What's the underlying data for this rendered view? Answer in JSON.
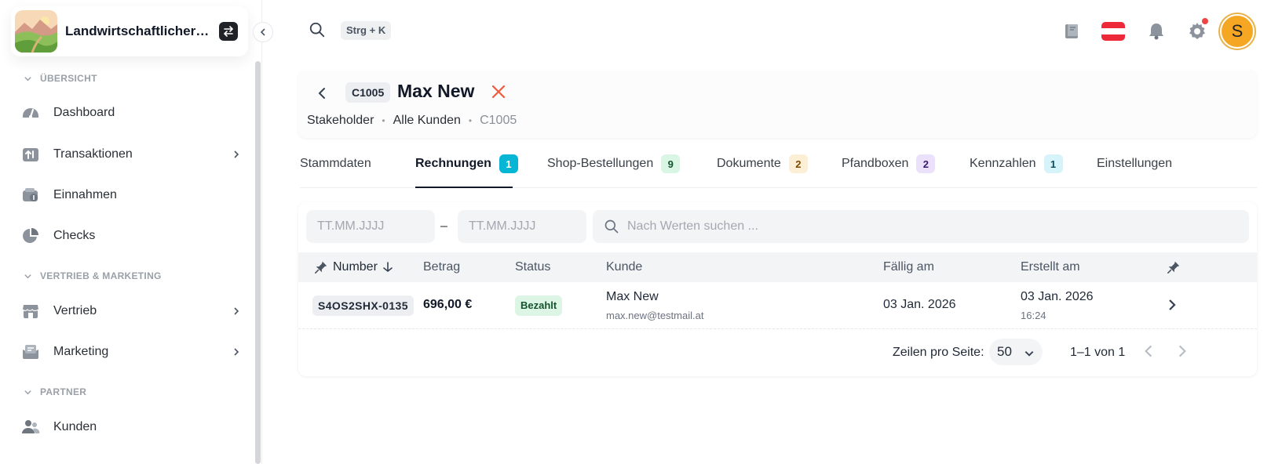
{
  "org": {
    "name": "Landwirtschaftlicher B..."
  },
  "sidebar": {
    "sections": [
      {
        "title": "ÜBERSICHT"
      },
      {
        "title": "VERTRIEB & MARKETING"
      },
      {
        "title": "PARTNER"
      }
    ],
    "items": [
      {
        "label": "Dashboard",
        "icon": "gauge-icon"
      },
      {
        "label": "Transaktionen",
        "icon": "transfer-icon"
      },
      {
        "label": "Einnahmen",
        "icon": "wallet-icon"
      },
      {
        "label": "Checks",
        "icon": "pie-chart-icon"
      },
      {
        "label": "Vertrieb",
        "icon": "store-icon"
      },
      {
        "label": "Marketing",
        "icon": "megaphone-icon"
      },
      {
        "label": "Kunden",
        "icon": "users-icon"
      }
    ]
  },
  "topbar": {
    "shortcut": "Strg + K",
    "avatar_initial": "S",
    "notification_dot_color": "#ef4444"
  },
  "customer": {
    "id": "C1005",
    "name": "Max New",
    "breadcrumb": [
      "Stakeholder",
      "Alle Kunden",
      "C1005"
    ]
  },
  "tabs": [
    {
      "label": "Stammdaten",
      "badge": null
    },
    {
      "label": "Rechnungen",
      "badge": "1",
      "badge_bg": "#06b6d4",
      "badge_fg": "#ffffff",
      "active": true
    },
    {
      "label": "Shop-Bestellungen",
      "badge": "9",
      "badge_bg": "#d9f5e3",
      "badge_fg": "#14532d"
    },
    {
      "label": "Dokumente",
      "badge": "2",
      "badge_bg": "#fdefd6",
      "badge_fg": "#7c4a03"
    },
    {
      "label": "Pfandboxen",
      "badge": "2",
      "badge_bg": "#ebe1fb",
      "badge_fg": "#3b1a73"
    },
    {
      "label": "Kennzahlen",
      "badge": "1",
      "badge_bg": "#d6f3fa",
      "badge_fg": "#0c4a5a"
    },
    {
      "label": "Einstellungen",
      "badge": null
    }
  ],
  "filters": {
    "date_from_placeholder": "TT.MM.JJJJ",
    "date_to_placeholder": "TT.MM.JJJJ",
    "date_separator": "–",
    "search_placeholder": "Nach Werten suchen ..."
  },
  "table": {
    "columns": [
      "Number",
      "Betrag",
      "Status",
      "Kunde",
      "Fällig am",
      "Erstellt am"
    ],
    "rows": [
      {
        "number": "S4OS2SHX-0135",
        "amount": "696,00 €",
        "status": "Bezahlt",
        "customer_name": "Max New",
        "customer_email": "max.new@testmail.at",
        "due": "03 Jan. 2026",
        "created_date": "03 Jan. 2026",
        "created_time": "16:24"
      }
    ]
  },
  "pagination": {
    "rows_per_page_label": "Zeilen pro Seite:",
    "rows_per_page": "50",
    "range": "1–1 von 1"
  }
}
